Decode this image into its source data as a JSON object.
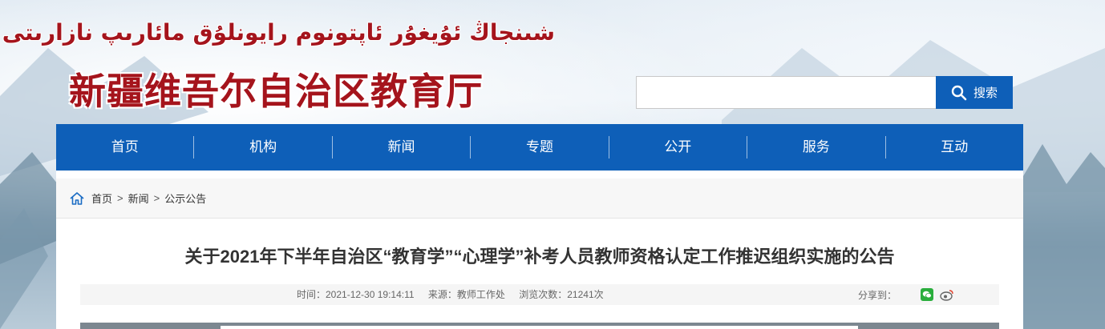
{
  "header": {
    "uyghur_title": "شىنجاڭ ئۇيغۇر ئاپتونوم رايونلۇق مائارىپ نازارىتى",
    "cn_title": "新疆维吾尔自治区教育厅"
  },
  "search": {
    "placeholder": "",
    "value": "",
    "button_label": "搜索"
  },
  "nav": {
    "items": [
      "首页",
      "机构",
      "新闻",
      "专题",
      "公开",
      "服务",
      "互动"
    ]
  },
  "breadcrumb": {
    "home": "首页",
    "sep1": ">",
    "news": "新闻",
    "sep2": ">",
    "current": "公示公告"
  },
  "article": {
    "title": "关于2021年下半年自治区“教育学”“心理学”补考人员教师资格认定工作推迟组织实施的公告",
    "time": "时间：2021-12-30 19:14:11",
    "source": "来源：教师工作处",
    "views": "浏览次数：21241次",
    "share_label": "分享到："
  },
  "colors": {
    "brand_blue": "#0e5fb8",
    "title_red": "#a5141c",
    "wechat_green": "#2aae3d"
  }
}
